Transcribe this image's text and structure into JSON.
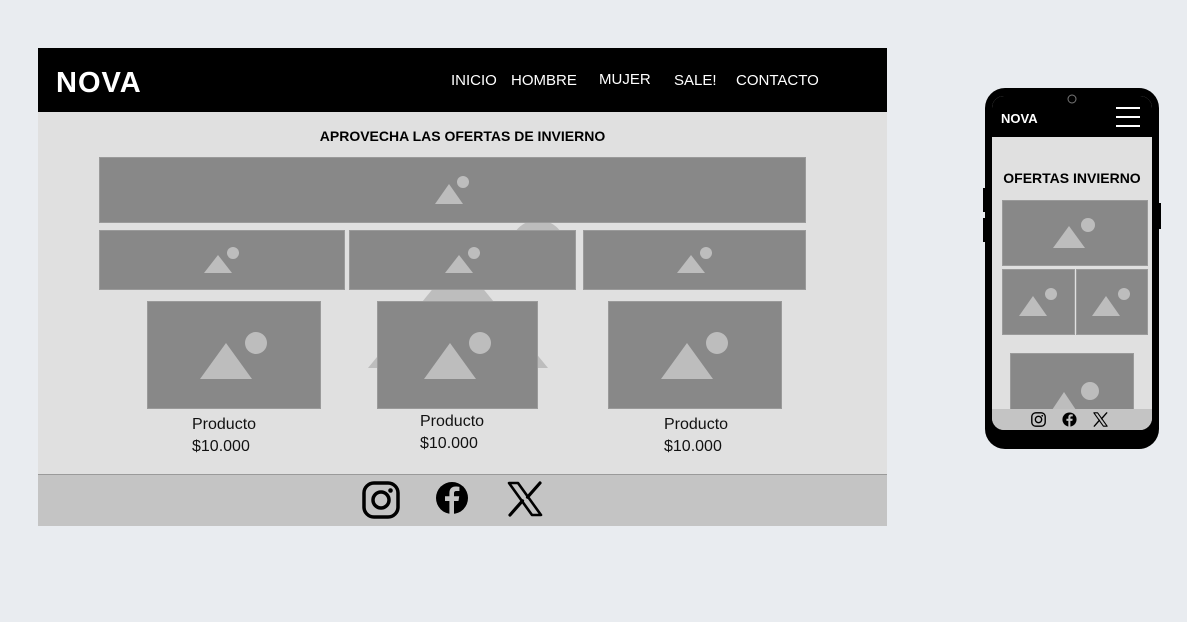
{
  "desktop": {
    "brand": "NOVA",
    "nav": [
      "INICIO",
      "HOMBRE",
      "MUJER",
      "SALE!",
      "CONTACTO"
    ],
    "headline": "APROVECHA LAS OFERTAS DE INVIERNO",
    "products": [
      {
        "name": "Producto",
        "price": "$10.000"
      },
      {
        "name": "Producto",
        "price": "$10.000"
      },
      {
        "name": "Producto",
        "price": "$10.000"
      }
    ],
    "social": [
      "instagram-icon",
      "facebook-icon",
      "x-icon"
    ]
  },
  "mobile": {
    "brand": "NOVA",
    "headline": "OFERTAS INVIERNO",
    "menu_icon": "hamburger-icon",
    "social": [
      "instagram-icon",
      "facebook-icon",
      "x-icon"
    ]
  },
  "colors": {
    "nav_bg": "#000000",
    "content_bg": "#e0e0e0",
    "placeholder": "#888888",
    "footer_bg": "#c4c4c4",
    "page_bg": "#e9ecf0"
  }
}
